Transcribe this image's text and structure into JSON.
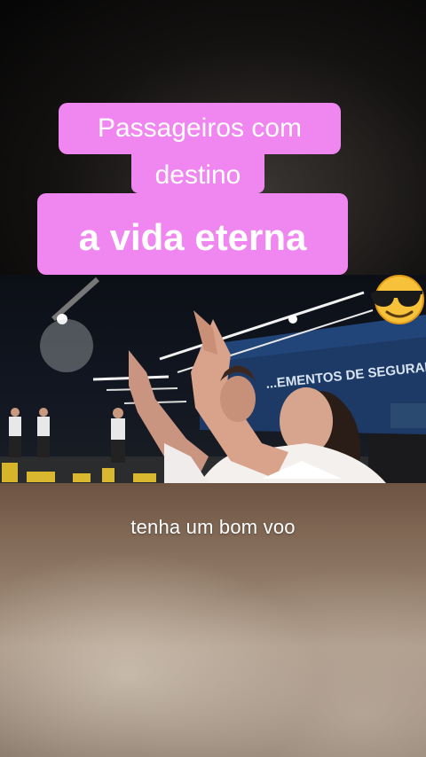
{
  "overlay": {
    "line1": "Passageiros com",
    "line2": "destino",
    "line3": "a vida eterna",
    "subtitle": "tenha um bom voo"
  },
  "video": {
    "stage_sign": "...EMENTOS DE SEGURANÇA"
  },
  "icons": {
    "emoji": "sunglasses-emoji"
  },
  "colors": {
    "caption_bg": "#f086f0",
    "caption_text": "#ffffff"
  }
}
